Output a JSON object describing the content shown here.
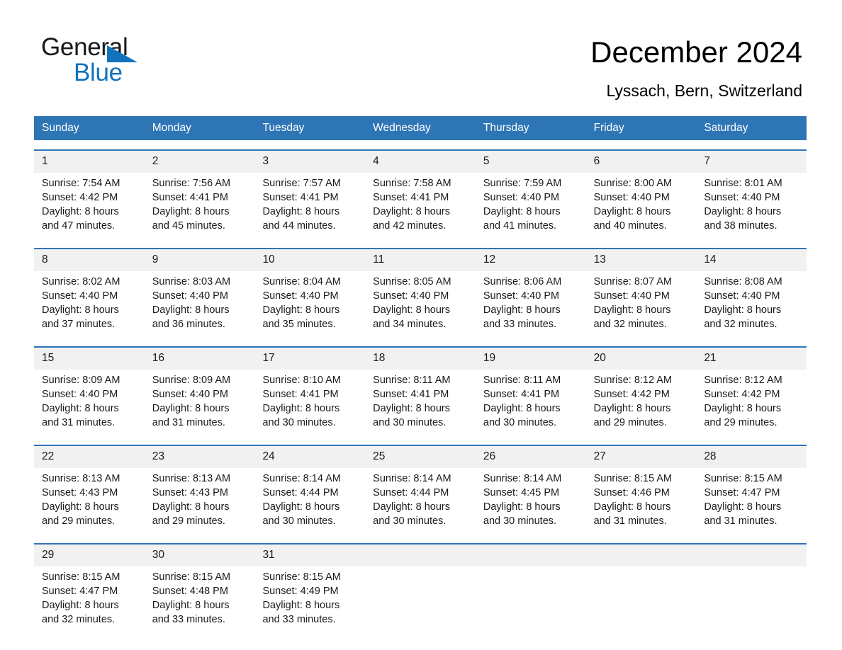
{
  "brand": {
    "name_part1": "General",
    "name_part2": "Blue",
    "triangle_icon": "triangle-icon",
    "accent_color": "#1273bd"
  },
  "header": {
    "month_title": "December 2024",
    "location": "Lyssach, Bern, Switzerland"
  },
  "theme": {
    "header_blue": "#2e75b6",
    "row_divider_blue": "#2e75b6",
    "daynum_band": "#f1f1f1",
    "text": "#1a1a1a"
  },
  "calendar": {
    "weekdays": [
      "Sunday",
      "Monday",
      "Tuesday",
      "Wednesday",
      "Thursday",
      "Friday",
      "Saturday"
    ],
    "weeks": [
      {
        "days": [
          {
            "num": "1",
            "l1": "Sunrise: 7:54 AM",
            "l2": "Sunset: 4:42 PM",
            "l3": "Daylight: 8 hours",
            "l4": "and 47 minutes."
          },
          {
            "num": "2",
            "l1": "Sunrise: 7:56 AM",
            "l2": "Sunset: 4:41 PM",
            "l3": "Daylight: 8 hours",
            "l4": "and 45 minutes."
          },
          {
            "num": "3",
            "l1": "Sunrise: 7:57 AM",
            "l2": "Sunset: 4:41 PM",
            "l3": "Daylight: 8 hours",
            "l4": "and 44 minutes."
          },
          {
            "num": "4",
            "l1": "Sunrise: 7:58 AM",
            "l2": "Sunset: 4:41 PM",
            "l3": "Daylight: 8 hours",
            "l4": "and 42 minutes."
          },
          {
            "num": "5",
            "l1": "Sunrise: 7:59 AM",
            "l2": "Sunset: 4:40 PM",
            "l3": "Daylight: 8 hours",
            "l4": "and 41 minutes."
          },
          {
            "num": "6",
            "l1": "Sunrise: 8:00 AM",
            "l2": "Sunset: 4:40 PM",
            "l3": "Daylight: 8 hours",
            "l4": "and 40 minutes."
          },
          {
            "num": "7",
            "l1": "Sunrise: 8:01 AM",
            "l2": "Sunset: 4:40 PM",
            "l3": "Daylight: 8 hours",
            "l4": "and 38 minutes."
          }
        ]
      },
      {
        "days": [
          {
            "num": "8",
            "l1": "Sunrise: 8:02 AM",
            "l2": "Sunset: 4:40 PM",
            "l3": "Daylight: 8 hours",
            "l4": "and 37 minutes."
          },
          {
            "num": "9",
            "l1": "Sunrise: 8:03 AM",
            "l2": "Sunset: 4:40 PM",
            "l3": "Daylight: 8 hours",
            "l4": "and 36 minutes."
          },
          {
            "num": "10",
            "l1": "Sunrise: 8:04 AM",
            "l2": "Sunset: 4:40 PM",
            "l3": "Daylight: 8 hours",
            "l4": "and 35 minutes."
          },
          {
            "num": "11",
            "l1": "Sunrise: 8:05 AM",
            "l2": "Sunset: 4:40 PM",
            "l3": "Daylight: 8 hours",
            "l4": "and 34 minutes."
          },
          {
            "num": "12",
            "l1": "Sunrise: 8:06 AM",
            "l2": "Sunset: 4:40 PM",
            "l3": "Daylight: 8 hours",
            "l4": "and 33 minutes."
          },
          {
            "num": "13",
            "l1": "Sunrise: 8:07 AM",
            "l2": "Sunset: 4:40 PM",
            "l3": "Daylight: 8 hours",
            "l4": "and 32 minutes."
          },
          {
            "num": "14",
            "l1": "Sunrise: 8:08 AM",
            "l2": "Sunset: 4:40 PM",
            "l3": "Daylight: 8 hours",
            "l4": "and 32 minutes."
          }
        ]
      },
      {
        "days": [
          {
            "num": "15",
            "l1": "Sunrise: 8:09 AM",
            "l2": "Sunset: 4:40 PM",
            "l3": "Daylight: 8 hours",
            "l4": "and 31 minutes."
          },
          {
            "num": "16",
            "l1": "Sunrise: 8:09 AM",
            "l2": "Sunset: 4:40 PM",
            "l3": "Daylight: 8 hours",
            "l4": "and 31 minutes."
          },
          {
            "num": "17",
            "l1": "Sunrise: 8:10 AM",
            "l2": "Sunset: 4:41 PM",
            "l3": "Daylight: 8 hours",
            "l4": "and 30 minutes."
          },
          {
            "num": "18",
            "l1": "Sunrise: 8:11 AM",
            "l2": "Sunset: 4:41 PM",
            "l3": "Daylight: 8 hours",
            "l4": "and 30 minutes."
          },
          {
            "num": "19",
            "l1": "Sunrise: 8:11 AM",
            "l2": "Sunset: 4:41 PM",
            "l3": "Daylight: 8 hours",
            "l4": "and 30 minutes."
          },
          {
            "num": "20",
            "l1": "Sunrise: 8:12 AM",
            "l2": "Sunset: 4:42 PM",
            "l3": "Daylight: 8 hours",
            "l4": "and 29 minutes."
          },
          {
            "num": "21",
            "l1": "Sunrise: 8:12 AM",
            "l2": "Sunset: 4:42 PM",
            "l3": "Daylight: 8 hours",
            "l4": "and 29 minutes."
          }
        ]
      },
      {
        "days": [
          {
            "num": "22",
            "l1": "Sunrise: 8:13 AM",
            "l2": "Sunset: 4:43 PM",
            "l3": "Daylight: 8 hours",
            "l4": "and 29 minutes."
          },
          {
            "num": "23",
            "l1": "Sunrise: 8:13 AM",
            "l2": "Sunset: 4:43 PM",
            "l3": "Daylight: 8 hours",
            "l4": "and 29 minutes."
          },
          {
            "num": "24",
            "l1": "Sunrise: 8:14 AM",
            "l2": "Sunset: 4:44 PM",
            "l3": "Daylight: 8 hours",
            "l4": "and 30 minutes."
          },
          {
            "num": "25",
            "l1": "Sunrise: 8:14 AM",
            "l2": "Sunset: 4:44 PM",
            "l3": "Daylight: 8 hours",
            "l4": "and 30 minutes."
          },
          {
            "num": "26",
            "l1": "Sunrise: 8:14 AM",
            "l2": "Sunset: 4:45 PM",
            "l3": "Daylight: 8 hours",
            "l4": "and 30 minutes."
          },
          {
            "num": "27",
            "l1": "Sunrise: 8:15 AM",
            "l2": "Sunset: 4:46 PM",
            "l3": "Daylight: 8 hours",
            "l4": "and 31 minutes."
          },
          {
            "num": "28",
            "l1": "Sunrise: 8:15 AM",
            "l2": "Sunset: 4:47 PM",
            "l3": "Daylight: 8 hours",
            "l4": "and 31 minutes."
          }
        ]
      },
      {
        "days": [
          {
            "num": "29",
            "l1": "Sunrise: 8:15 AM",
            "l2": "Sunset: 4:47 PM",
            "l3": "Daylight: 8 hours",
            "l4": "and 32 minutes."
          },
          {
            "num": "30",
            "l1": "Sunrise: 8:15 AM",
            "l2": "Sunset: 4:48 PM",
            "l3": "Daylight: 8 hours",
            "l4": "and 33 minutes."
          },
          {
            "num": "31",
            "l1": "Sunrise: 8:15 AM",
            "l2": "Sunset: 4:49 PM",
            "l3": "Daylight: 8 hours",
            "l4": "and 33 minutes."
          },
          {
            "num": "",
            "l1": "",
            "l2": "",
            "l3": "",
            "l4": ""
          },
          {
            "num": "",
            "l1": "",
            "l2": "",
            "l3": "",
            "l4": ""
          },
          {
            "num": "",
            "l1": "",
            "l2": "",
            "l3": "",
            "l4": ""
          },
          {
            "num": "",
            "l1": "",
            "l2": "",
            "l3": "",
            "l4": ""
          }
        ]
      }
    ]
  }
}
